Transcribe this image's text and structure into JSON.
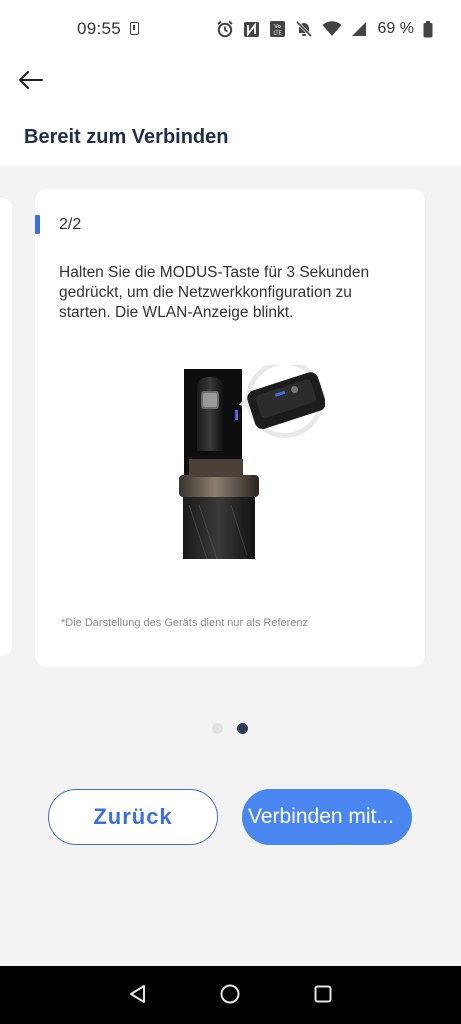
{
  "status_bar": {
    "time": "09:55",
    "battery_text": "69 %",
    "icons": [
      "sim-card-icon",
      "alarm-icon",
      "nfc-icon",
      "volte-icon",
      "do-not-disturb-off-icon",
      "wifi-icon",
      "cell-signal-icon",
      "battery-icon"
    ]
  },
  "header": {
    "back_icon": "arrow-left-icon",
    "title": "Bereit zum Verbinden"
  },
  "card": {
    "step": "2/2",
    "instruction": "Halten Sie die MODUS-Taste für 3 Sekunden gedrückt, um die Netzwerkkonfiguration zu starten. Die WLAN-Anzeige blinkt.",
    "disclaimer": "*Die Darstellung des Geräts dient nur als Referenz"
  },
  "pagination": {
    "current": 2,
    "total": 2
  },
  "buttons": {
    "back_label": "Zurück",
    "connect_label": "Verbinden mit..."
  },
  "colors": {
    "accent": "#3b6fe0",
    "primary_button": "#4a86f0",
    "title": "#1f2d4a"
  },
  "nav_bar": {
    "icons": [
      "nav-back-icon",
      "nav-home-icon",
      "nav-recents-icon"
    ]
  }
}
